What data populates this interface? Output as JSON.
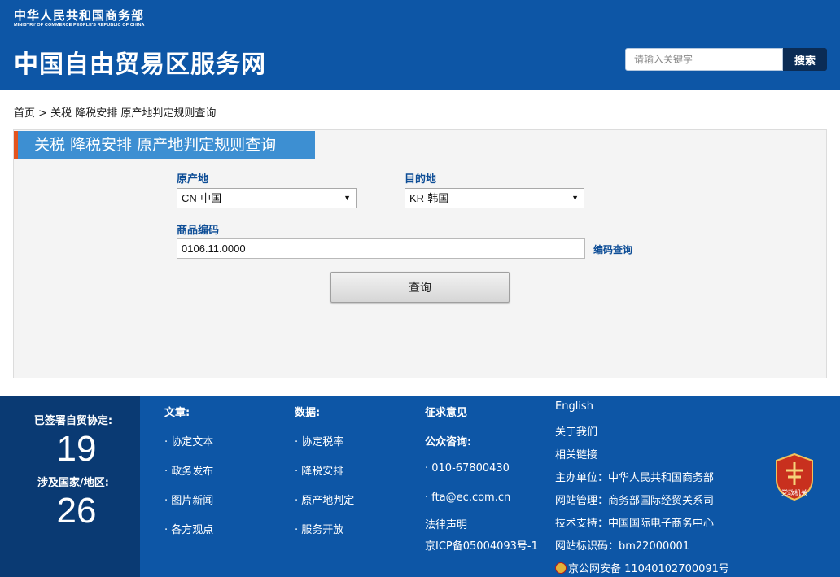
{
  "header": {
    "ministry_cn": "中华人民共和国商务部",
    "ministry_en": "MINISTRY OF COMMERCE PEOPLE'S REPUBLIC OF CHINA",
    "site_title": "中国自由贸易区服务网",
    "search_placeholder": "请输入关键字",
    "search_button": "搜索"
  },
  "breadcrumb": "首页 > 关税 降税安排 原产地判定规则查询",
  "panel": {
    "title": "关税  降税安排  原产地判定规则查询",
    "origin_label": "原产地",
    "origin_value": "CN-中国",
    "destination_label": "目的地",
    "destination_value": "KR-韩国",
    "code_label": "商品编码",
    "code_value": "0106.11.0000",
    "code_lookup_link": "编码查询",
    "query_button": "查询"
  },
  "footer": {
    "stats": {
      "agreements_label": "已签署自贸协定:",
      "agreements_count": "19",
      "countries_label": "涉及国家/地区:",
      "countries_count": "26"
    },
    "articles": {
      "title": "文章:",
      "items": [
        "协定文本",
        "政务发布",
        "图片新闻",
        "各方观点"
      ]
    },
    "data": {
      "title": "数据:",
      "items": [
        "协定税率",
        "降税安排",
        "原产地判定",
        "服务开放"
      ]
    },
    "contact": {
      "feedback": "征求意见",
      "consult_title": "公众咨询:",
      "phone": "010-67800430",
      "email": "fta@ec.com.cn",
      "legal": "法律声明",
      "icp": "京ICP备05004093号-1"
    },
    "info": {
      "english": "English",
      "about": "关于我们",
      "links": "相关链接",
      "sponsor": "主办单位：中华人民共和国商务部",
      "manager": "网站管理：商务部国际经贸关系司",
      "support": "技术支持：中国国际电子商务中心",
      "site_id": "网站标识码：bm22000001",
      "police": "京公网安备 11040102700091号"
    },
    "badge_text": "党政机关",
    "colors": {
      "primary": "#0d56a6",
      "dark": "#0a3a73",
      "accent": "#e4541d"
    }
  }
}
